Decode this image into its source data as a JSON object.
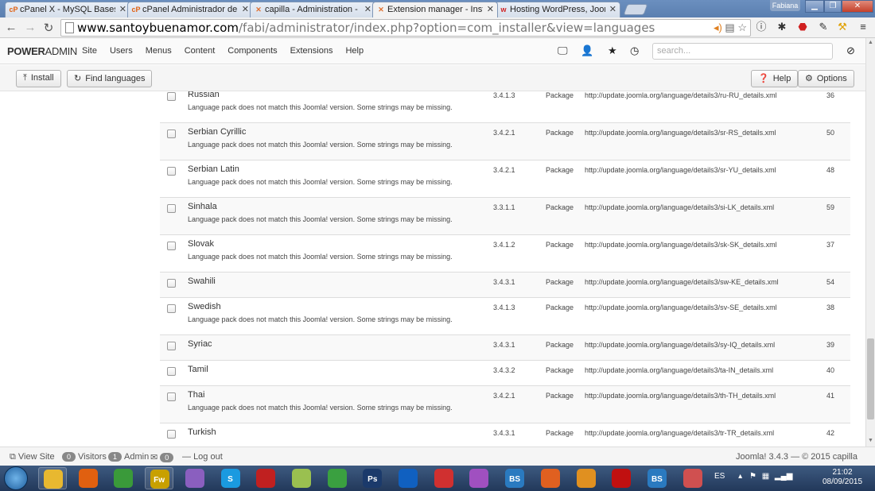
{
  "browser": {
    "tabs": [
      {
        "icon": "cP",
        "title": "cPanel X - MySQL Bases d"
      },
      {
        "icon": "cP",
        "title": "cPanel Administrador de a"
      },
      {
        "icon": "✕",
        "title": "capilla - Administration - I"
      },
      {
        "icon": "✕",
        "title": "Extension manager - Insta"
      },
      {
        "icon": "w",
        "title": "Hosting WordPress, Joom"
      }
    ],
    "user": "Fabiana",
    "url_host": "www.santoybuenamor.com",
    "url_path": "/fabi/administrator/index.php?option=com_installer&view=languages"
  },
  "header": {
    "brand_bold": "POWER",
    "brand_light": "ADMIN",
    "nav": [
      "Site",
      "Users",
      "Menus",
      "Content",
      "Components",
      "Extensions",
      "Help"
    ],
    "search_placeholder": "search..."
  },
  "toolbar": {
    "install": "Install",
    "find_languages": "Find languages",
    "help": "Help",
    "options": "Options"
  },
  "languages": [
    {
      "name": "Russian",
      "warning": "Language pack does not match this Joomla! version. Some strings may be missing.",
      "version": "3.4.1.3",
      "type": "Package",
      "url": "http://update.joomla.org/language/details3/ru-RU_details.xml",
      "id": "36"
    },
    {
      "name": "Serbian Cyrillic",
      "warning": "Language pack does not match this Joomla! version. Some strings may be missing.",
      "version": "3.4.2.1",
      "type": "Package",
      "url": "http://update.joomla.org/language/details3/sr-RS_details.xml",
      "id": "50"
    },
    {
      "name": "Serbian Latin",
      "warning": "Language pack does not match this Joomla! version. Some strings may be missing.",
      "version": "3.4.2.1",
      "type": "Package",
      "url": "http://update.joomla.org/language/details3/sr-YU_details.xml",
      "id": "48"
    },
    {
      "name": "Sinhala",
      "warning": "Language pack does not match this Joomla! version. Some strings may be missing.",
      "version": "3.3.1.1",
      "type": "Package",
      "url": "http://update.joomla.org/language/details3/si-LK_details.xml",
      "id": "59"
    },
    {
      "name": "Slovak",
      "warning": "Language pack does not match this Joomla! version. Some strings may be missing.",
      "version": "3.4.1.2",
      "type": "Package",
      "url": "http://update.joomla.org/language/details3/sk-SK_details.xml",
      "id": "37"
    },
    {
      "name": "Swahili",
      "warning": "",
      "version": "3.4.3.1",
      "type": "Package",
      "url": "http://update.joomla.org/language/details3/sw-KE_details.xml",
      "id": "54"
    },
    {
      "name": "Swedish",
      "warning": "Language pack does not match this Joomla! version. Some strings may be missing.",
      "version": "3.4.1.3",
      "type": "Package",
      "url": "http://update.joomla.org/language/details3/sv-SE_details.xml",
      "id": "38"
    },
    {
      "name": "Syriac",
      "warning": "",
      "version": "3.4.3.1",
      "type": "Package",
      "url": "http://update.joomla.org/language/details3/sy-IQ_details.xml",
      "id": "39"
    },
    {
      "name": "Tamil",
      "warning": "",
      "version": "3.4.3.2",
      "type": "Package",
      "url": "http://update.joomla.org/language/details3/ta-IN_details.xml",
      "id": "40"
    },
    {
      "name": "Thai",
      "warning": "Language pack does not match this Joomla! version. Some strings may be missing.",
      "version": "3.4.2.1",
      "type": "Package",
      "url": "http://update.joomla.org/language/details3/th-TH_details.xml",
      "id": "41"
    },
    {
      "name": "Turkish",
      "warning": "",
      "version": "3.4.3.1",
      "type": "Package",
      "url": "http://update.joomla.org/language/details3/tr-TR_details.xml",
      "id": "42"
    }
  ],
  "statusbar": {
    "view_site": "View Site",
    "visitors_count": "0",
    "visitors": "Visitors",
    "admin_count": "1",
    "admin": "Admin",
    "messages_count": "0",
    "logout": "Log out",
    "copyright": "Joomla! 3.4.3 — © 2015 capilla"
  },
  "taskbar": {
    "apps": [
      {
        "icon": "folder-icon",
        "label": "",
        "color": "#e8b830"
      },
      {
        "icon": "media-player-icon",
        "label": "",
        "color": "#e06010"
      },
      {
        "icon": "chrome-icon",
        "label": "",
        "color": "#3a9a3a"
      },
      {
        "icon": "fireworks-icon",
        "label": "Fw",
        "color": "#c8a000"
      },
      {
        "icon": "scissors-icon",
        "label": "",
        "color": "#8a5fbf"
      },
      {
        "icon": "skype-icon",
        "label": "S",
        "color": "#1a9ae0"
      },
      {
        "icon": "pen-icon",
        "label": "",
        "color": "#c02020"
      },
      {
        "icon": "folder-2-icon",
        "label": "",
        "color": "#9ac050"
      },
      {
        "icon": "utorrent-icon",
        "label": "",
        "color": "#3aa040"
      },
      {
        "icon": "photoshop-icon",
        "label": "Ps",
        "color": "#1b3a6b"
      },
      {
        "icon": "teamviewer-icon",
        "label": "",
        "color": "#1060c0"
      },
      {
        "icon": "gift-icon",
        "label": "",
        "color": "#d03030"
      },
      {
        "icon": "picasa-icon",
        "label": "",
        "color": "#a050c0"
      },
      {
        "icon": "bs-icon",
        "label": "BS",
        "color": "#2a7ac0"
      },
      {
        "icon": "firefox-icon",
        "label": "",
        "color": "#e06020"
      },
      {
        "icon": "vlc-icon",
        "label": "",
        "color": "#e09020"
      },
      {
        "icon": "acrobat-icon",
        "label": "",
        "color": "#c01010"
      },
      {
        "icon": "bs-2-icon",
        "label": "BS",
        "color": "#2a7ac0"
      },
      {
        "icon": "grid-icon",
        "label": "",
        "color": "#d05050"
      }
    ],
    "language": "ES",
    "time": "21:02",
    "date": "08/09/2015"
  }
}
